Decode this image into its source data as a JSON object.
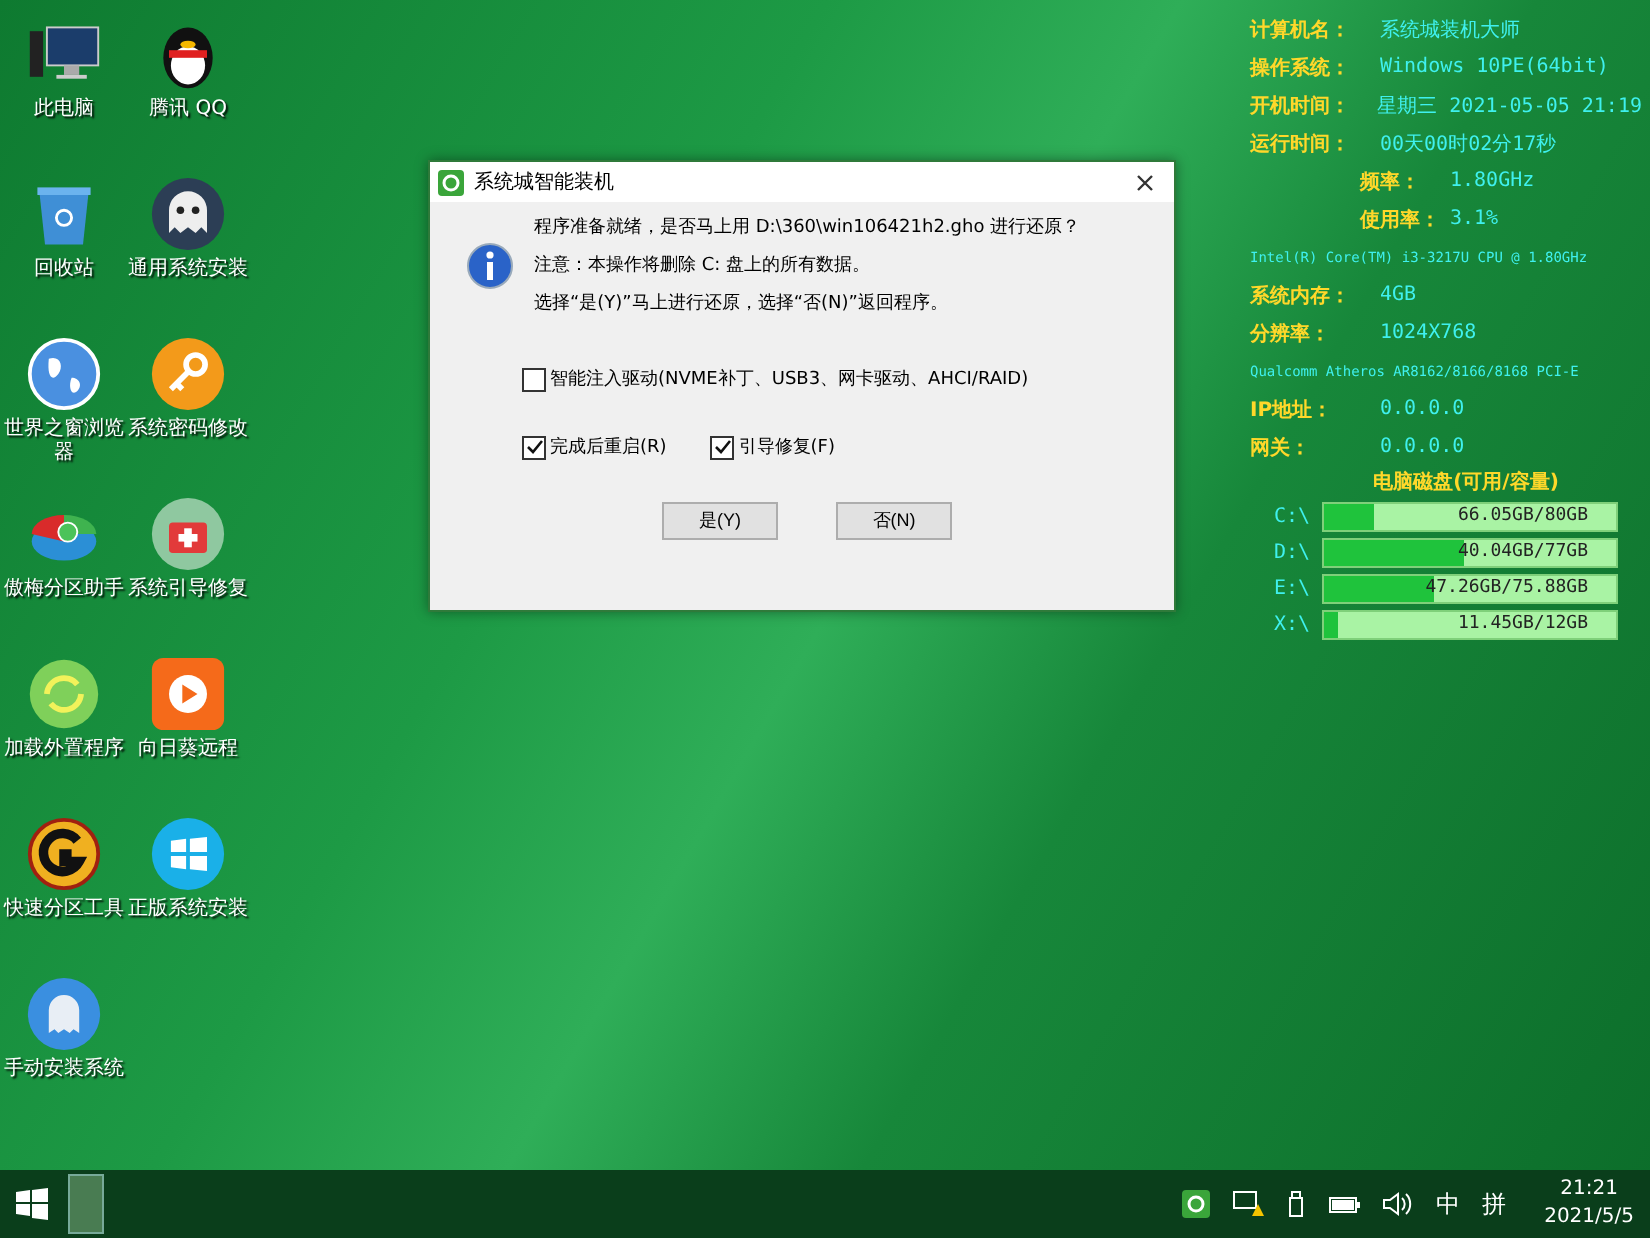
{
  "desktop_icons": [
    {
      "label": "此电脑",
      "kind": "computer"
    },
    {
      "label": "腾讯 QQ",
      "kind": "penguin"
    },
    {
      "label": "回收站",
      "kind": "bin"
    },
    {
      "label": "通用系统安装",
      "kind": "ghost"
    },
    {
      "label": "世界之窗浏览器",
      "kind": "globe"
    },
    {
      "label": "系统密码修改",
      "kind": "key"
    },
    {
      "label": "傲梅分区助手",
      "kind": "disk"
    },
    {
      "label": "系统引导修复",
      "kind": "medkit"
    },
    {
      "label": "加载外置程序",
      "kind": "refresh"
    },
    {
      "label": "向日葵远程",
      "kind": "sun"
    },
    {
      "label": "快速分区工具",
      "kind": "g"
    },
    {
      "label": "正版系统安装",
      "kind": "windows"
    },
    {
      "label": "手动安装系统",
      "kind": "spirit"
    }
  ],
  "info_panel": {
    "rows": [
      {
        "kind": "pair",
        "label": "计算机名：",
        "value": "系统城装机大师"
      },
      {
        "kind": "pair",
        "label": "操作系统：",
        "value": "Windows 10PE(64bit)"
      },
      {
        "kind": "pair",
        "label": "开机时间：",
        "value": "星期三 2021-05-05 21:19"
      },
      {
        "kind": "pair",
        "label": "运行时间：",
        "value": "00天00时02分17秒"
      },
      {
        "kind": "indent",
        "label": "频率：",
        "value": "1.80GHz"
      },
      {
        "kind": "indent",
        "label": "使用率：",
        "value": "3.1%"
      },
      {
        "kind": "note",
        "value": "Intel(R) Core(TM) i3-3217U CPU @ 1.80GHz"
      },
      {
        "kind": "pair",
        "label": "系统内存：",
        "value": "4GB"
      },
      {
        "kind": "pair",
        "label": "分辨率：",
        "value": "1024X768"
      },
      {
        "kind": "note",
        "value": "Qualcomm Atheros AR8162/8166/8168 PCI-E"
      },
      {
        "kind": "pair",
        "label": "IP地址：",
        "value": "0.0.0.0"
      },
      {
        "kind": "pair",
        "label": "网关：",
        "value": "0.0.0.0"
      }
    ],
    "disk_title": "电脑磁盘(可用/容量)",
    "disks": [
      {
        "drive": "C:\\",
        "text": "66.05GB/80GB",
        "level": 0.17
      },
      {
        "drive": "D:\\",
        "text": "40.04GB/77GB",
        "level": 0.48
      },
      {
        "drive": "E:\\",
        "text": "47.26GB/75.88GB",
        "level": 0.38
      },
      {
        "drive": "X:\\",
        "text": "11.45GB/12GB",
        "level": 0.05
      }
    ]
  },
  "dialog": {
    "title": "系统城智能装机",
    "messages": [
      "程序准备就绪，是否马上用 D:\\360\\win106421h2.gho 进行还原？",
      "注意：本操作将删除 C: 盘上的所有数据。",
      "选择“是(Y)”马上进行还原，选择“否(N)”返回程序。"
    ],
    "option_rows": [
      [
        {
          "label": "智能注入驱动(NVME补丁、USB3、网卡驱动、AHCI/RAID)",
          "checked": false
        }
      ],
      [
        {
          "label": "完成后重启(R)",
          "checked": true
        },
        {
          "label": "引导修复(F)",
          "checked": true
        }
      ]
    ],
    "buttons": [
      "是(Y)",
      "否(N)"
    ]
  },
  "taskbar": {
    "tray": [
      "中",
      "拼"
    ],
    "time": "21:21",
    "date": "2021/5/5"
  }
}
